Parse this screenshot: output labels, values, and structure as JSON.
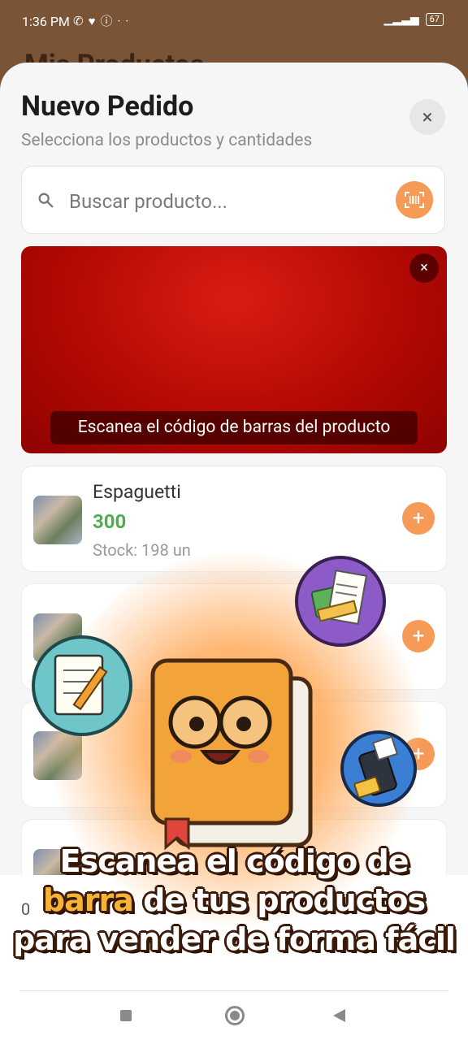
{
  "status_bar": {
    "time": "1:36 PM",
    "icons": [
      "whatsapp-icon",
      "heart-icon",
      "info-icon",
      "more-dots-icon"
    ],
    "battery": "67"
  },
  "background_title": "Mis Productos",
  "sheet": {
    "title": "Nuevo Pedido",
    "subtitle": "Selecciona los productos y cantidades",
    "close_icon": "×"
  },
  "search": {
    "value": "",
    "placeholder": "Buscar producto..."
  },
  "scanner": {
    "label": "Escanea el código de barras del producto",
    "close_icon": "×"
  },
  "products": [
    {
      "name": "Espaguetti",
      "price": "300",
      "stock": "Stock: 198 un"
    }
  ],
  "bottom": {
    "count": "0"
  },
  "promo": {
    "line1": "Escanea el código de",
    "line2_highlight": "barra",
    "line2_rest": " de tus productos",
    "line3": "para vender de forma fácil"
  },
  "colors": {
    "accent": "#f59a57",
    "price": "#4caf50",
    "scanner": "#b40904",
    "highlight": "#f7b335"
  }
}
